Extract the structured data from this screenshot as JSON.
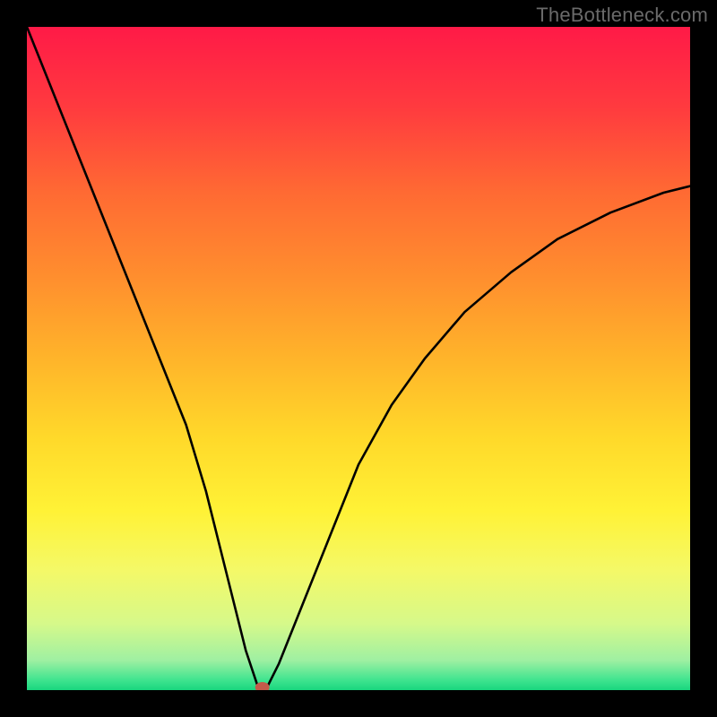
{
  "watermark": "TheBottleneck.com",
  "chart_data": {
    "type": "line",
    "title": "",
    "xlabel": "",
    "ylabel": "",
    "xlim": [
      0,
      100
    ],
    "ylim": [
      0,
      100
    ],
    "grid": false,
    "legend": false,
    "series": [
      {
        "name": "bottleneck-curve",
        "x": [
          0,
          4,
          8,
          12,
          16,
          20,
          24,
          27,
          29,
          31,
          33,
          35,
          36,
          38,
          42,
          46,
          50,
          55,
          60,
          66,
          73,
          80,
          88,
          96,
          100
        ],
        "y": [
          100,
          90,
          80,
          70,
          60,
          50,
          40,
          30,
          22,
          14,
          6,
          0,
          0,
          4,
          14,
          24,
          34,
          43,
          50,
          57,
          63,
          68,
          72,
          75,
          76
        ]
      }
    ],
    "background_gradient": {
      "stops": [
        {
          "offset": 0.0,
          "color": "#ff1a47"
        },
        {
          "offset": 0.12,
          "color": "#ff3a3f"
        },
        {
          "offset": 0.25,
          "color": "#ff6a33"
        },
        {
          "offset": 0.38,
          "color": "#ff8f2e"
        },
        {
          "offset": 0.5,
          "color": "#ffb42a"
        },
        {
          "offset": 0.62,
          "color": "#ffd92a"
        },
        {
          "offset": 0.73,
          "color": "#fff236"
        },
        {
          "offset": 0.82,
          "color": "#f4f968"
        },
        {
          "offset": 0.9,
          "color": "#d6f98a"
        },
        {
          "offset": 0.955,
          "color": "#9ff0a2"
        },
        {
          "offset": 0.985,
          "color": "#3fe48f"
        },
        {
          "offset": 1.0,
          "color": "#19d67e"
        }
      ]
    },
    "marker": {
      "x": 35.5,
      "y": 0,
      "color": "#c45a4a",
      "rx": 8,
      "ry": 6
    }
  },
  "colors": {
    "frame": "#000000",
    "curve": "#000000",
    "watermark": "#6a6a6a"
  }
}
